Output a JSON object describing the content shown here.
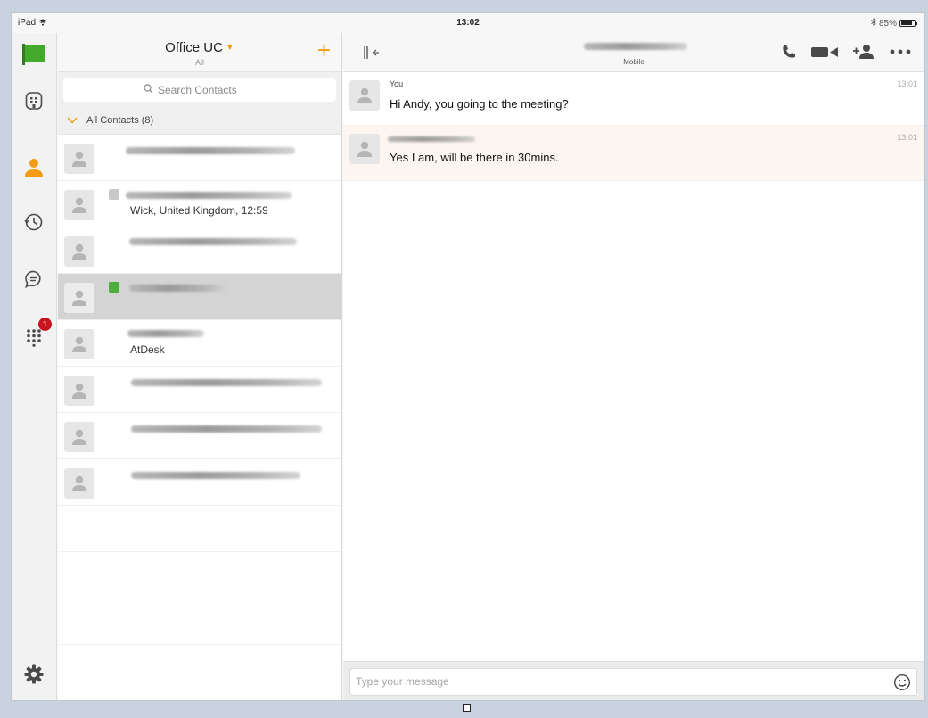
{
  "status_bar": {
    "device": "iPad",
    "time": "13:02",
    "battery": "85%",
    "battery_level": 0.85
  },
  "rail": {
    "chat_badge_count": "1"
  },
  "contacts": {
    "title": "Office UC",
    "filter": "All",
    "search_placeholder": "Search Contacts",
    "group_label": "All Contacts (8)",
    "rows": [
      {
        "subtitle": ""
      },
      {
        "subtitle": "Wick, United Kingdom, 12:59"
      },
      {
        "subtitle": ""
      },
      {
        "subtitle": ""
      },
      {
        "subtitle": "AtDesk"
      },
      {
        "subtitle": ""
      },
      {
        "subtitle": ""
      },
      {
        "subtitle": ""
      }
    ]
  },
  "chat": {
    "device_label": "Mobile",
    "messages": [
      {
        "sender": "You",
        "time": "13:01",
        "text": "Hi Andy, you going to the meeting?"
      },
      {
        "sender": "",
        "time": "13:01",
        "text": "Yes I am, will be there in 30mins."
      }
    ],
    "composer_placeholder": "Type your message"
  },
  "colors": {
    "accent": "#f39c12",
    "presence_green": "#4cae3c",
    "incoming_bg": "#fdf5f0",
    "badge_red": "#c8141e"
  }
}
